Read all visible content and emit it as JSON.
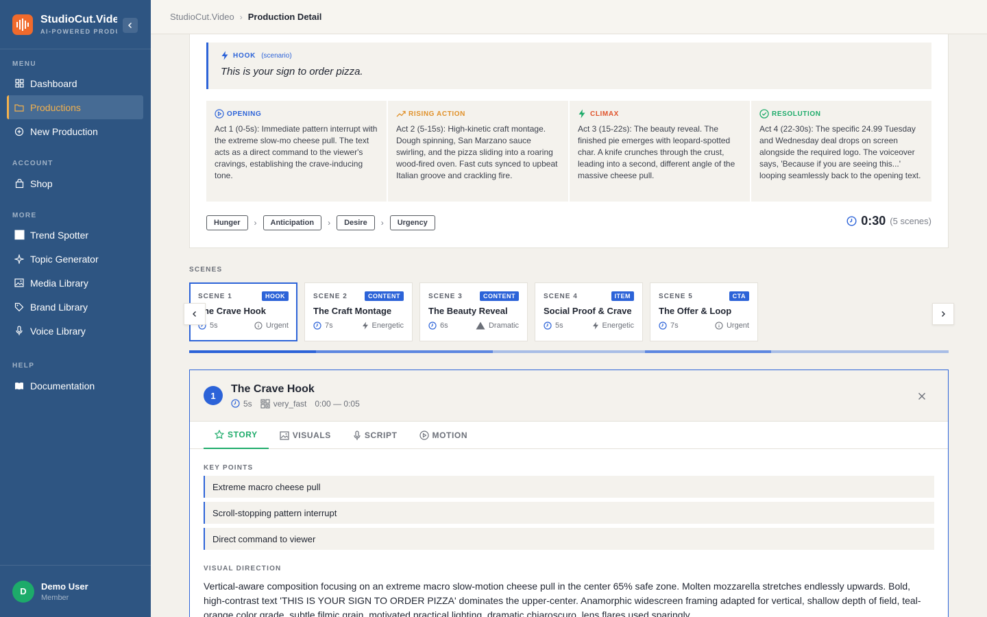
{
  "brand": {
    "name": "StudioCut.Video",
    "tagline": "AI-POWERED PRODUCTION"
  },
  "sidebar": {
    "menu_label": "MENU",
    "menu": [
      {
        "label": "Dashboard"
      },
      {
        "label": "Productions"
      },
      {
        "label": "New Production"
      }
    ],
    "account_label": "ACCOUNT",
    "account": [
      {
        "label": "Shop"
      }
    ],
    "more_label": "MORE",
    "more": [
      {
        "label": "Trend Spotter"
      },
      {
        "label": "Topic Generator"
      },
      {
        "label": "Media Library"
      },
      {
        "label": "Brand Library"
      },
      {
        "label": "Voice Library"
      }
    ],
    "help_label": "HELP",
    "help": [
      {
        "label": "Documentation"
      }
    ],
    "user": {
      "initial": "D",
      "name": "Demo User",
      "role": "Member"
    }
  },
  "breadcrumb": {
    "root": "StudioCut.Video",
    "sep": "›",
    "current": "Production Detail"
  },
  "story": {
    "hook": {
      "label": "HOOK",
      "type": "(scenario)",
      "text": "This is your sign to order pizza."
    },
    "acts": [
      {
        "label": "OPENING",
        "icon": "play-circle-icon",
        "color": "#2c63d8",
        "text": "Act 1 (0-5s): Immediate pattern interrupt with the extreme slow-mo cheese pull. The text acts as a direct command to the viewer's cravings, establishing the crave-inducing tone."
      },
      {
        "label": "RISING ACTION",
        "icon": "trending-up-icon",
        "color": "#e0912a",
        "text": "Act 2 (5-15s): High-kinetic craft montage. Dough spinning, San Marzano sauce swirling, and the pizza sliding into a roaring wood-fired oven. Fast cuts synced to upbeat Italian groove and crackling fire."
      },
      {
        "label": "CLIMAX",
        "icon": "lightning-icon",
        "color": "#e0542c",
        "text": "Act 3 (15-22s): The beauty reveal. The finished pie emerges with leopard-spotted char. A knife crunches through the crust, leading into a second, different angle of the massive cheese pull."
      },
      {
        "label": "RESOLUTION",
        "icon": "check-circle-icon",
        "color": "#1dab6a",
        "text": "Act 4 (22-30s): The specific 24.99 Tuesday and Wednesday deal drops on screen alongside the required logo. The voiceover says, 'Because if you are seeing this...' looping seamlessly back to the opening text."
      }
    ],
    "emotions": [
      "Hunger",
      "Anticipation",
      "Desire",
      "Urgency"
    ],
    "duration": "0:30",
    "scene_count": "(5 scenes)"
  },
  "scenes_label": "SCENES",
  "scenes": [
    {
      "num": "SCENE 1",
      "badge": "HOOK",
      "title": "The Crave Hook",
      "duration": "5s",
      "mood": "Urgent",
      "mood_icon": "info-icon"
    },
    {
      "num": "SCENE 2",
      "badge": "CONTENT",
      "title": "The Craft Montage",
      "duration": "7s",
      "mood": "Energetic",
      "mood_icon": "lightning-icon"
    },
    {
      "num": "SCENE 3",
      "badge": "CONTENT",
      "title": "The Beauty Reveal",
      "duration": "6s",
      "mood": "Dramatic",
      "mood_icon": "triangle-icon"
    },
    {
      "num": "SCENE 4",
      "badge": "ITEM",
      "title": "Social Proof & Crave",
      "duration": "5s",
      "mood": "Energetic",
      "mood_icon": "lightning-icon"
    },
    {
      "num": "SCENE 5",
      "badge": "CTA",
      "title": "The Offer & Loop",
      "duration": "7s",
      "mood": "Urgent",
      "mood_icon": "info-icon"
    }
  ],
  "detail": {
    "number": "1",
    "title": "The Crave Hook",
    "duration": "5s",
    "pace": "very_fast",
    "time_range": "0:00 — 0:05",
    "tabs": [
      {
        "label": "STORY"
      },
      {
        "label": "VISUALS"
      },
      {
        "label": "SCRIPT"
      },
      {
        "label": "MOTION"
      }
    ],
    "active_tab": "STORY",
    "key_points_label": "KEY POINTS",
    "key_points": [
      "Extreme macro cheese pull",
      "Scroll-stopping pattern interrupt",
      "Direct command to viewer"
    ],
    "visual_direction_label": "VISUAL DIRECTION",
    "visual_direction": "Vertical-aware composition focusing on an extreme macro slow-motion cheese pull in the center 65% safe zone. Molten mozzarella stretches endlessly upwards. Bold, high-contrast text 'THIS IS YOUR SIGN TO ORDER PIZZA' dominates the upper-center. Anamorphic widescreen framing adapted for vertical, shallow depth of field, teal-orange color grade, subtle filmic grain, motivated practical lighting, dramatic chiaroscuro, lens flares used sparingly."
  },
  "colors": {
    "sidebar": "#2e5582",
    "accent": "#2c63d8",
    "active_nav": "#f3b14d",
    "success": "#1dab6a",
    "logo": "#f06a2c"
  }
}
